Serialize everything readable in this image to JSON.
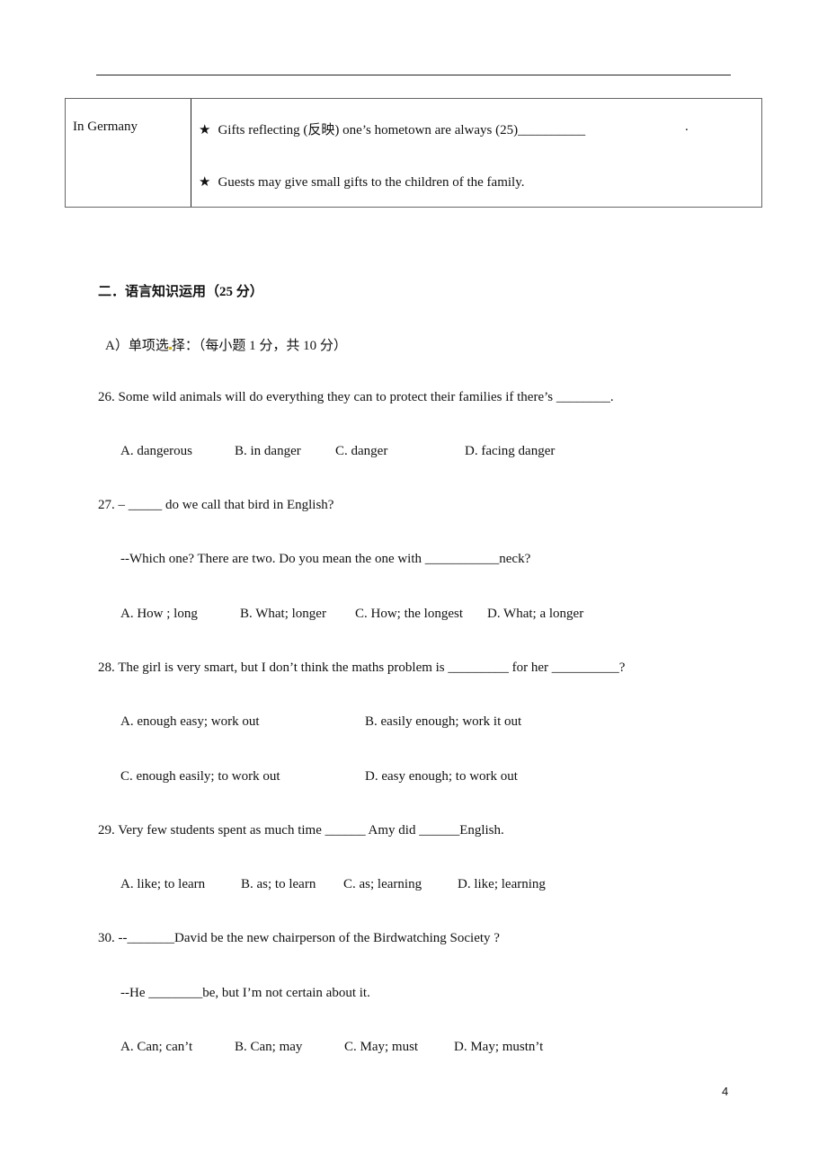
{
  "table": {
    "row_label": "In Germany",
    "bullet_icon": "★",
    "bullets": [
      "Gifts reflecting (反映) one’s hometown are always (25)__________",
      "Guests may give small gifts to the children of the family."
    ],
    "trailing_period": "."
  },
  "section": {
    "title": "二．语言知识运用（25 分）",
    "subtitle_part1": "A）单项选",
    "subtitle_part2": "择：（每小题 1 分，共 10 分）"
  },
  "questions": [
    {
      "stem": "26. Some wild animals will do everything they can to protect their families if there’s ________.",
      "options": [
        "A. dangerous",
        "B. in danger",
        "C. danger",
        "D. facing danger"
      ]
    },
    {
      "stem": "27. – _____ do we call that bird in English?",
      "stem2": "--Which one? There are two. Do you mean the one with ___________neck?",
      "options": [
        "A. How ; long",
        "B. What; longer",
        "C. How; the longest",
        "D. What; a longer"
      ]
    },
    {
      "stem": "28. The girl is very smart, but I don’t think the maths problem is _________ for her __________?",
      "options": [
        "A. enough easy; work out",
        "B. easily enough; work it out",
        "C. enough easily; to work out",
        "D. easy enough; to work out"
      ]
    },
    {
      "stem": "29. Very few students spent as much time ______ Amy did ______English.",
      "options": [
        "A. like; to learn",
        "B. as; to learn",
        "C. as; learning",
        "D. like; learning"
      ]
    },
    {
      "stem": "30. --_______David be the new chairperson of the Birdwatching Society ?",
      "stem2": "--He ________be, but I’m not certain about it.",
      "options": [
        "A. Can; can’t",
        "B. Can; may",
        "C. May; must",
        "D. May; mustn’t"
      ]
    }
  ],
  "page_number": "4"
}
